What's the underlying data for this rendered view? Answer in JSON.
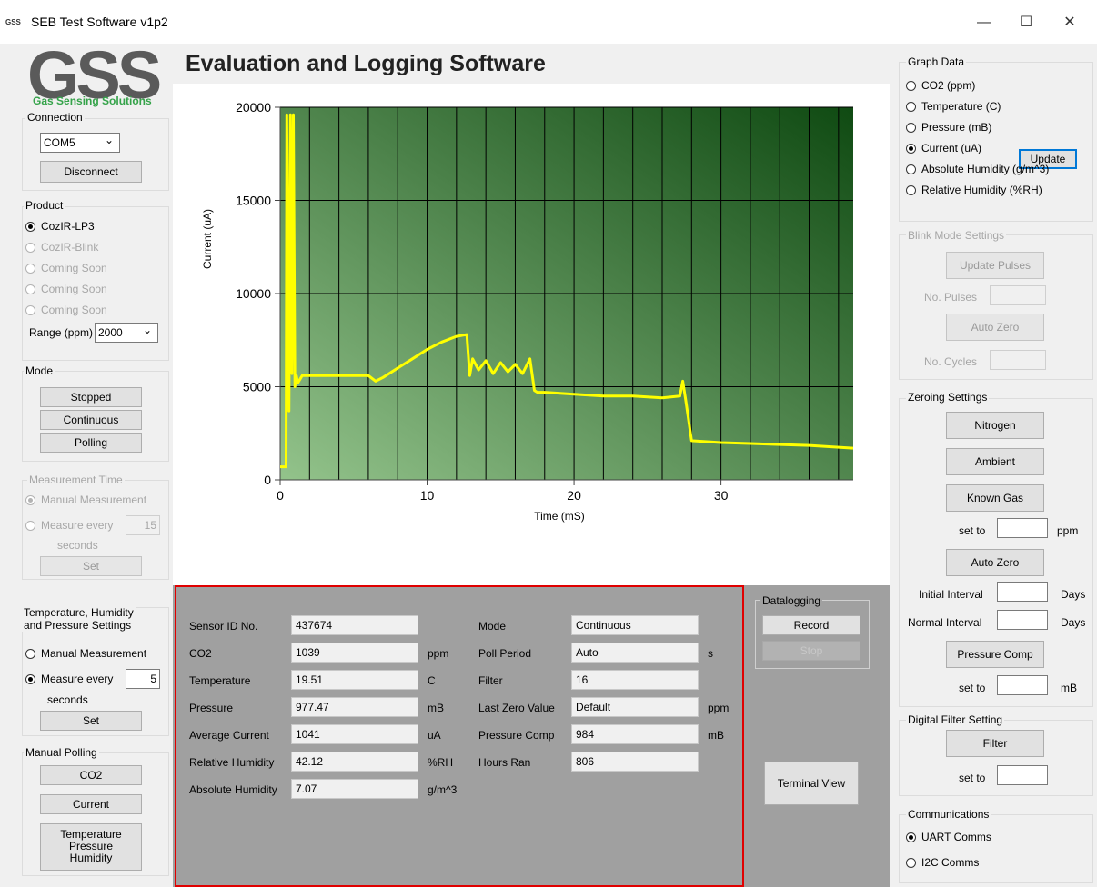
{
  "window": {
    "icon_text": "GSS",
    "title": "SEB Test Software v1p2",
    "minimize": "—",
    "maximize": "☐",
    "close": "✕"
  },
  "logo": {
    "text": "GSS",
    "tagline": "Gas Sensing Solutions"
  },
  "header": {
    "title": "Evaluation and Logging Software"
  },
  "connection": {
    "label": "Connection",
    "port": "COM5",
    "disconnect": "Disconnect"
  },
  "product": {
    "label": "Product",
    "options": [
      "CozIR-LP3",
      "CozIR-Blink",
      "Coming Soon",
      "Coming Soon",
      "Coming Soon"
    ],
    "range_label": "Range (ppm)",
    "range_value": "2000"
  },
  "mode": {
    "label": "Mode",
    "buttons": [
      "Stopped",
      "Continuous",
      "Polling"
    ]
  },
  "measurement_time": {
    "label": "Measurement Time",
    "manual": "Manual Measurement",
    "every": "Measure every",
    "every_value": "15",
    "seconds": "seconds",
    "set": "Set"
  },
  "thp": {
    "label_line1": "Temperature, Humidity",
    "label_line2": "and Pressure Settings",
    "manual": "Manual Measurement",
    "every": "Measure every",
    "every_value": "5",
    "seconds": "seconds",
    "set": "Set"
  },
  "manual_polling": {
    "label": "Manual Polling",
    "co2": "CO2",
    "current": "Current",
    "tph_l1": "Temperature",
    "tph_l2": "Pressure",
    "tph_l3": "Humidity"
  },
  "graph_data": {
    "label": "Graph Data",
    "options": [
      "CO2 (ppm)",
      "Temperature (C)",
      "Pressure (mB)",
      "Current (uA)",
      "Absolute Humidity (g/m^3)",
      "Relative Humidity (%RH)"
    ],
    "selected": 3,
    "update": "Update"
  },
  "blink": {
    "label": "Blink Mode Settings",
    "update_pulses": "Update Pulses",
    "no_pulses": "No. Pulses",
    "auto_zero": "Auto Zero",
    "no_cycles": "No. Cycles"
  },
  "zeroing": {
    "label": "Zeroing Settings",
    "nitrogen": "Nitrogen",
    "ambient": "Ambient",
    "known_gas": "Known Gas",
    "set_to": "set to",
    "ppm": "ppm",
    "auto_zero": "Auto Zero",
    "initial_interval": "Initial Interval",
    "normal_interval": "Normal Interval",
    "days": "Days",
    "pressure_comp": "Pressure Comp",
    "mb": "mB"
  },
  "digital_filter": {
    "label": "Digital Filter Setting",
    "filter": "Filter",
    "set_to": "set to"
  },
  "communications": {
    "label": "Communications",
    "uart": "UART Comms",
    "i2c": "I2C Comms"
  },
  "readings": {
    "left": [
      {
        "label": "Sensor ID No.",
        "value": "437674",
        "unit": ""
      },
      {
        "label": "CO2",
        "value": "1039",
        "unit": "ppm"
      },
      {
        "label": "Temperature",
        "value": "19.51",
        "unit": "C"
      },
      {
        "label": "Pressure",
        "value": "977.47",
        "unit": "mB"
      },
      {
        "label": "Average Current",
        "value": "1041",
        "unit": "uA"
      },
      {
        "label": "Relative Humidity",
        "value": "42.12",
        "unit": "%RH"
      },
      {
        "label": "Absolute Humidity",
        "value": "7.07",
        "unit": "g/m^3"
      }
    ],
    "right": [
      {
        "label": "Mode",
        "value": "Continuous",
        "unit": ""
      },
      {
        "label": "Poll Period",
        "value": "Auto",
        "unit": "s"
      },
      {
        "label": "Filter",
        "value": "16",
        "unit": ""
      },
      {
        "label": "Last Zero Value",
        "value": "Default",
        "unit": "ppm"
      },
      {
        "label": "Pressure Comp",
        "value": "984",
        "unit": "mB"
      },
      {
        "label": "Hours Ran",
        "value": "806",
        "unit": ""
      }
    ]
  },
  "datalogging": {
    "label": "Datalogging",
    "record": "Record",
    "stop": "Stop",
    "terminal": "Terminal View"
  },
  "colors": {
    "highlight_border": "#e00000",
    "trace": "#ffff00",
    "plot_dark": "#0f4a12",
    "plot_light": "#93c38b"
  },
  "chart_data": {
    "type": "line",
    "xlabel": "Time (mS)",
    "ylabel": "Current (uA)",
    "xlim": [
      0,
      39
    ],
    "ylim": [
      0,
      20000
    ],
    "xticks": [
      0,
      10,
      20,
      30
    ],
    "yticks": [
      0,
      5000,
      10000,
      15000,
      20000
    ],
    "grid": true,
    "series": [
      {
        "x": [
          0,
          0.4,
          0.45,
          0.6,
          0.7,
          0.8,
          0.9,
          1.0,
          1.1,
          1.2,
          1.5,
          2,
          4,
          6,
          6.5,
          7,
          8,
          9,
          10,
          11,
          12,
          12.7,
          12.9,
          13.1,
          13.5,
          14,
          14.5,
          15,
          15.5,
          16,
          16.5,
          17,
          17.3,
          17.5,
          18,
          20,
          22,
          24,
          26,
          27.2,
          27.4,
          27.6,
          28,
          30,
          32,
          34,
          36,
          38,
          39
        ],
        "y": [
          700,
          700,
          19600,
          3700,
          19600,
          5700,
          19600,
          5000,
          5600,
          5200,
          5600,
          5600,
          5600,
          5600,
          5300,
          5500,
          6000,
          6500,
          7000,
          7400,
          7700,
          7800,
          5600,
          6500,
          5900,
          6400,
          5700,
          6300,
          5800,
          6200,
          5700,
          6500,
          4800,
          4700,
          4700,
          4600,
          4500,
          4500,
          4400,
          4500,
          5300,
          4300,
          2100,
          2000,
          1950,
          1900,
          1850,
          1750,
          1700
        ]
      }
    ]
  }
}
